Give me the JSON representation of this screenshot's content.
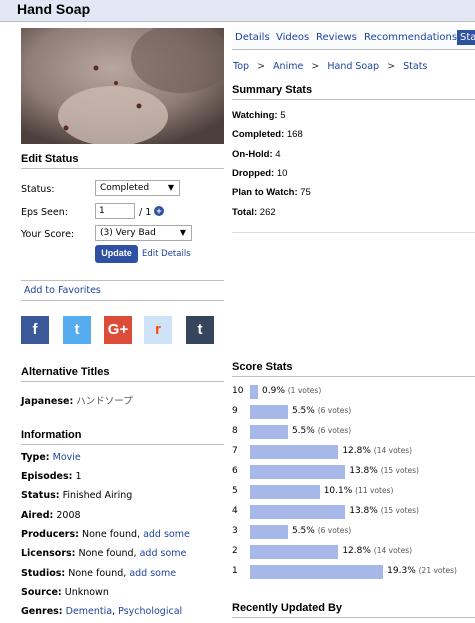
{
  "page_title": "Hand Soap",
  "tabs": [
    "Details",
    "Videos",
    "Reviews",
    "Recommendations",
    "Stats"
  ],
  "breadcrumb": [
    "Top",
    "Anime",
    "Hand Soap",
    "Stats"
  ],
  "breadcrumb_sep": ">",
  "edit_status": {
    "heading": "Edit Status",
    "status_label": "Status:",
    "status_value": "Completed",
    "eps_label": "Eps Seen:",
    "eps_value": "1",
    "eps_total": "/ 1",
    "score_label": "Your Score:",
    "score_value": "(3) Very Bad",
    "update_label": "Update",
    "edit_details_label": "Edit Details"
  },
  "favorites_label": "Add to Favorites",
  "social": [
    {
      "name": "facebook",
      "glyph": "f",
      "color": "#3b5998"
    },
    {
      "name": "twitter",
      "glyph": "t",
      "color": "#55acee"
    },
    {
      "name": "google-plus",
      "glyph": "G+",
      "color": "#dd4b39"
    },
    {
      "name": "reddit",
      "glyph": "r",
      "color": "#cee3f8"
    },
    {
      "name": "tumblr",
      "glyph": "t",
      "color": "#35465c"
    }
  ],
  "alt_titles": {
    "heading": "Alternative Titles",
    "japanese_label": "Japanese:",
    "japanese_value": "ハンドソープ"
  },
  "information": {
    "heading": "Information",
    "type_label": "Type:",
    "type_value": "Movie",
    "episodes_label": "Episodes:",
    "episodes_value": "1",
    "status_label": "Status:",
    "status_value": "Finished Airing",
    "aired_label": "Aired:",
    "aired_value": "2008",
    "producers_label": "Producers:",
    "producers_value": "None found,",
    "producers_add": "add some",
    "licensors_label": "Licensors:",
    "licensors_value": "None found,",
    "licensors_add": "add some",
    "studios_label": "Studios:",
    "studios_value": "None found,",
    "studios_add": "add some",
    "source_label": "Source:",
    "source_value": "Unknown",
    "genres_label": "Genres:",
    "genre_1": "Dementia",
    "genre_sep": ",",
    "genre_2": "Psychological"
  },
  "summary": {
    "heading": "Summary Stats",
    "watching_label": "Watching:",
    "watching_value": "5",
    "completed_label": "Completed:",
    "completed_value": "168",
    "onhold_label": "On-Hold:",
    "onhold_value": "4",
    "dropped_label": "Dropped:",
    "dropped_value": "10",
    "ptw_label": "Plan to Watch:",
    "ptw_value": "75",
    "total_label": "Total:",
    "total_value": "262"
  },
  "score_stats": {
    "heading": "Score Stats",
    "rows": [
      {
        "score": "10",
        "pct": 0.9,
        "pct_label": "0.9%",
        "votes": "(1 votes)"
      },
      {
        "score": "9",
        "pct": 5.5,
        "pct_label": "5.5%",
        "votes": "(6 votes)"
      },
      {
        "score": "8",
        "pct": 5.5,
        "pct_label": "5.5%",
        "votes": "(6 votes)"
      },
      {
        "score": "7",
        "pct": 12.8,
        "pct_label": "12.8%",
        "votes": "(14 votes)"
      },
      {
        "score": "6",
        "pct": 13.8,
        "pct_label": "13.8%",
        "votes": "(15 votes)"
      },
      {
        "score": "5",
        "pct": 10.1,
        "pct_label": "10.1%",
        "votes": "(11 votes)"
      },
      {
        "score": "4",
        "pct": 13.8,
        "pct_label": "13.8%",
        "votes": "(15 votes)"
      },
      {
        "score": "3",
        "pct": 5.5,
        "pct_label": "5.5%",
        "votes": "(6 votes)"
      },
      {
        "score": "2",
        "pct": 12.8,
        "pct_label": "12.8%",
        "votes": "(14 votes)"
      },
      {
        "score": "1",
        "pct": 19.3,
        "pct_label": "19.3%",
        "votes": "(21 votes)"
      }
    ]
  },
  "recently_updated_heading": "Recently Updated By"
}
